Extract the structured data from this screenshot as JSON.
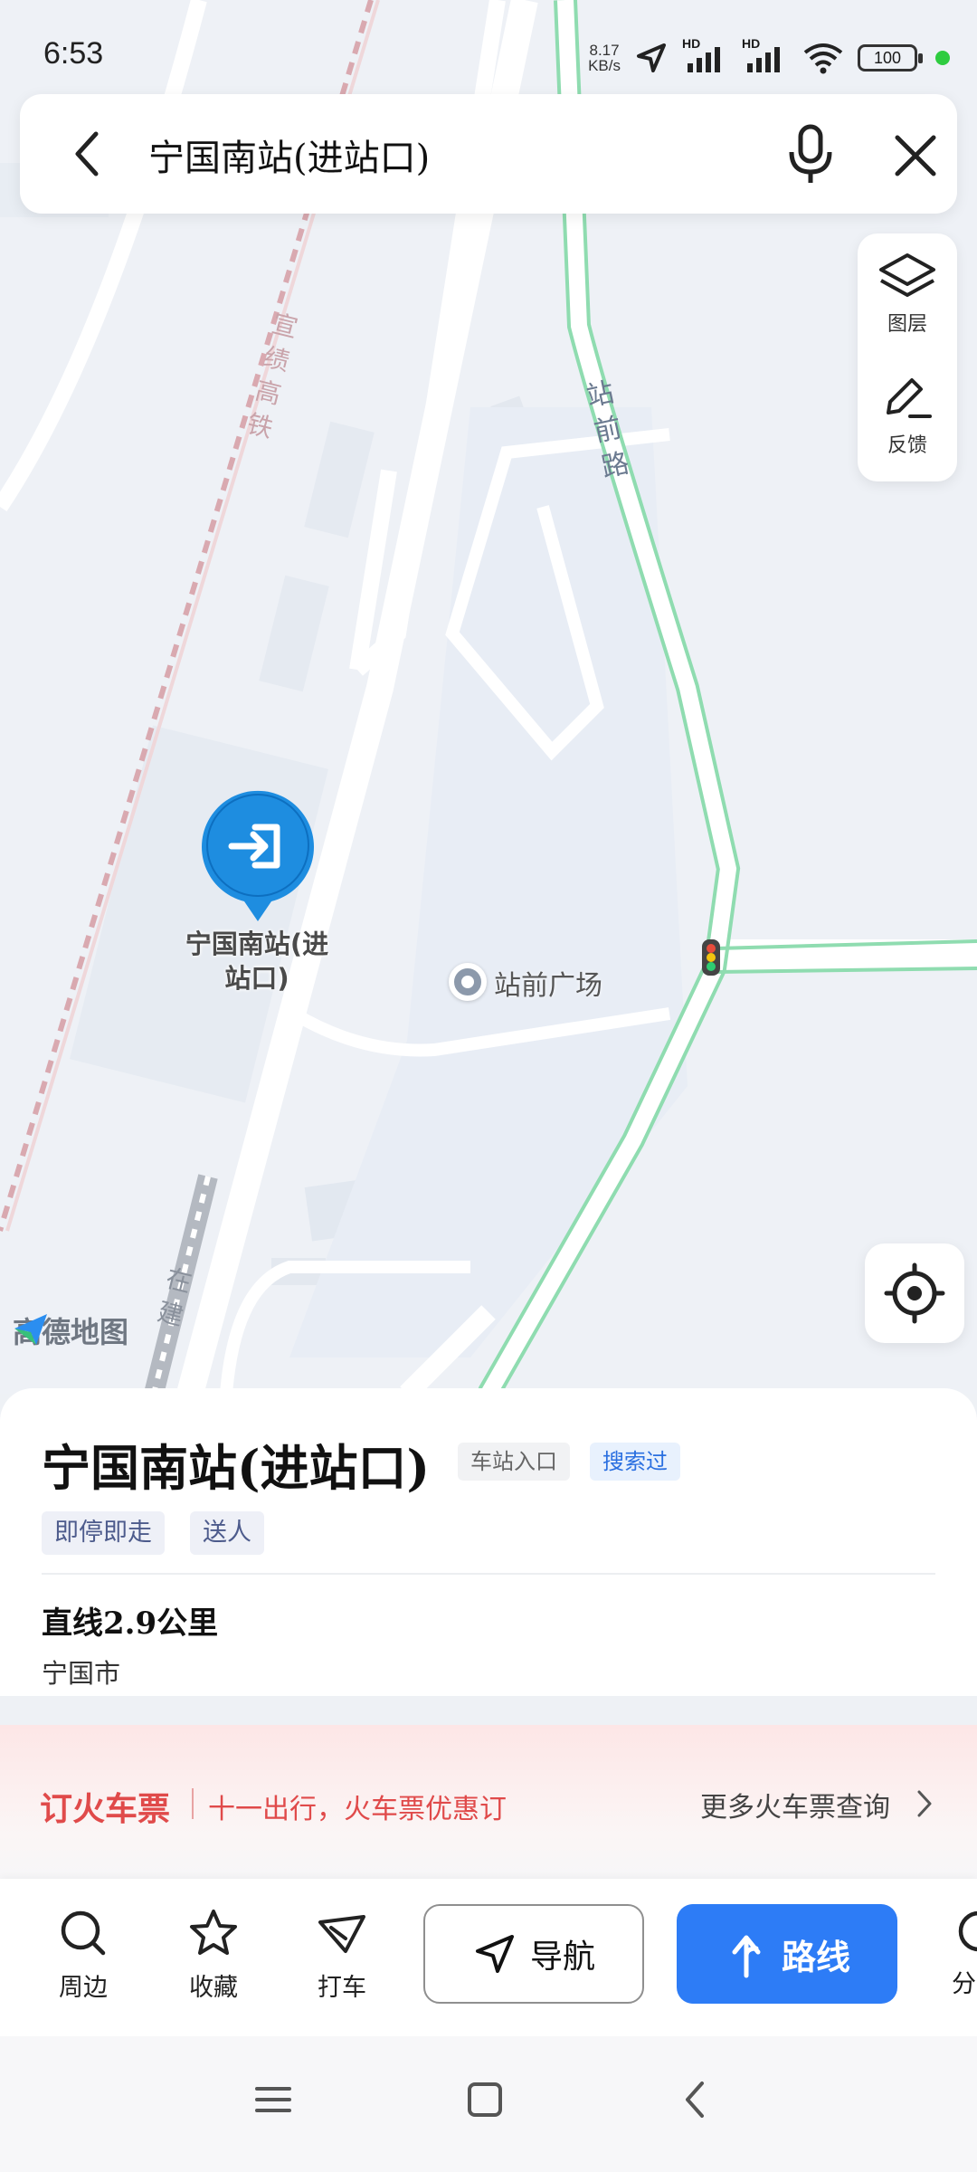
{
  "status_bar": {
    "time": "6:53",
    "net_speed_value": "8.17",
    "net_speed_unit": "KB/s",
    "signal_1_label": "HD",
    "signal_2_label": "HD",
    "battery": "100"
  },
  "search": {
    "query": "宁国南站(进站口)"
  },
  "map_tools": {
    "layers_label": "图层",
    "feedback_label": "反馈"
  },
  "map": {
    "rail_label": "宣绩高铁",
    "road_label": "站前路",
    "poi_label_line1": "宁国南站(进",
    "poi_label_line2": "站口)",
    "plaza_label": "站前广场",
    "construction_label": "在建",
    "brand": "高德地图"
  },
  "place": {
    "title": "宁国南站(进站口)",
    "tag_type": "车站入口",
    "tag_searched": "搜索过",
    "tags": [
      "即停即走",
      "送人"
    ],
    "distance": "直线2.9公里",
    "city": "宁国市"
  },
  "ticket_banner": {
    "title": "订火车票",
    "subtitle": "十一出行，火车票优惠订",
    "more": "更多火车票查询"
  },
  "actions": {
    "nearby": "周边",
    "favorite": "收藏",
    "taxi": "打车",
    "navigate": "导航",
    "route": "路线",
    "share_partial": "分"
  },
  "colors": {
    "accent_blue": "#2d7cf6",
    "ticket_red": "#e04a4a",
    "road_green": "#8fdcb0"
  }
}
